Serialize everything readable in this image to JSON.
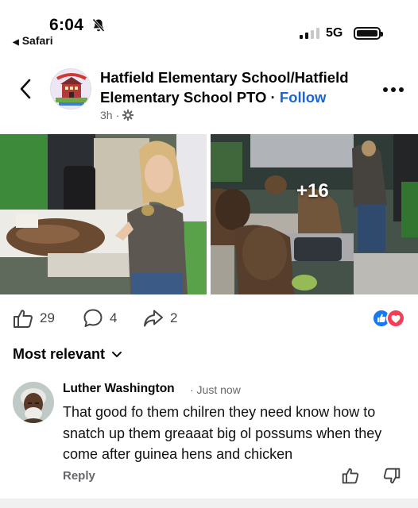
{
  "status_bar": {
    "time": "6:04",
    "back_app": "Safari",
    "network": "5G"
  },
  "post": {
    "page_name": "Hatfield Elementary School/Hatfield Elementary School PTO",
    "separator": " · ",
    "follow_label": "Follow",
    "age": "3h",
    "meta_separator": "·",
    "extra_photos": "+16",
    "likes": "29",
    "comments": "4",
    "shares": "2"
  },
  "comments_section": {
    "sort_label": "Most relevant",
    "comment": {
      "author": "Luther Washington",
      "time": "· Just now",
      "text": "That good fo them chilren they need know how to snatch up them greaaat big ol possums when they come after guinea hens and chicken",
      "reply_label": "Reply"
    }
  },
  "colors": {
    "accent": "#1a64d6",
    "like_blue": "#1877f2",
    "love_red": "#f33e58",
    "secondary_text": "#65676b"
  },
  "icons": [
    "bell-slash-icon",
    "back-chevron-icon",
    "more-icon",
    "globe-icon",
    "thumbs-up-icon",
    "comment-icon",
    "share-icon",
    "chevron-down-icon",
    "thumbs-down-icon"
  ]
}
